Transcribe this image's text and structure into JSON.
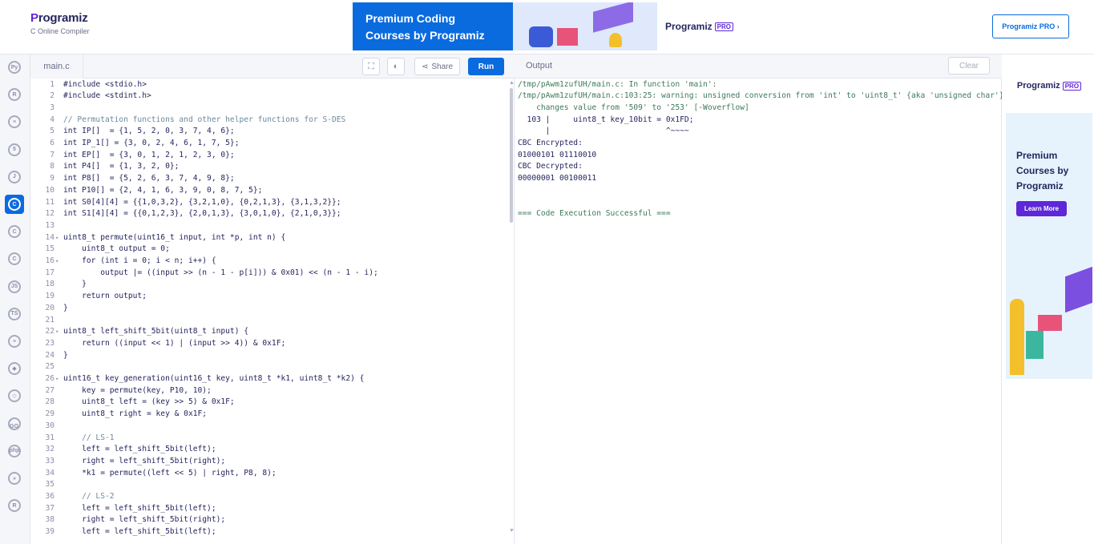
{
  "header": {
    "logo_name": "rogramiz",
    "logo_initial": "P",
    "logo_subtitle": "C Online Compiler",
    "banner_line1": "Premium Coding",
    "banner_line2": "Courses by Programiz",
    "banner_brand": "Programiz",
    "banner_pro": "PRO",
    "pro_button": "Programiz PRO ›"
  },
  "sidebar": {
    "languages": [
      {
        "name": "python-icon",
        "glyph": "Py"
      },
      {
        "name": "r-icon",
        "glyph": "R"
      },
      {
        "name": "sql-icon",
        "glyph": "≡"
      },
      {
        "name": "html-icon",
        "glyph": "5"
      },
      {
        "name": "java-icon",
        "glyph": "J"
      },
      {
        "name": "c-icon",
        "glyph": "C",
        "active": true
      },
      {
        "name": "cpp-icon",
        "glyph": "C"
      },
      {
        "name": "csharp-icon",
        "glyph": "C"
      },
      {
        "name": "javascript-icon",
        "glyph": "JS"
      },
      {
        "name": "typescript-icon",
        "glyph": "TS"
      },
      {
        "name": "kotlin-icon",
        "glyph": "≡"
      },
      {
        "name": "ruby-icon",
        "glyph": "◆"
      },
      {
        "name": "csharp2-icon",
        "glyph": "◇"
      },
      {
        "name": "go-icon",
        "glyph": "-GO"
      },
      {
        "name": "php-icon",
        "glyph": "php"
      },
      {
        "name": "swift-icon",
        "glyph": "»"
      },
      {
        "name": "rust-icon",
        "glyph": "R"
      }
    ]
  },
  "editor": {
    "tab_label": "main.c",
    "share_label": "Share",
    "run_label": "Run",
    "lines": [
      {
        "n": "1",
        "fold": "",
        "code": "#include <stdio.h>"
      },
      {
        "n": "2",
        "fold": "",
        "code": "#include <stdint.h>"
      },
      {
        "n": "3",
        "fold": "",
        "code": ""
      },
      {
        "n": "4",
        "fold": "",
        "code": "// Permutation functions and other helper functions for S-DES"
      },
      {
        "n": "5",
        "fold": "",
        "code": "int IP[]  = {1, 5, 2, 0, 3, 7, 4, 6};"
      },
      {
        "n": "6",
        "fold": "",
        "code": "int IP_1[] = {3, 0, 2, 4, 6, 1, 7, 5};"
      },
      {
        "n": "7",
        "fold": "",
        "code": "int EP[]  = {3, 0, 1, 2, 1, 2, 3, 0};"
      },
      {
        "n": "8",
        "fold": "",
        "code": "int P4[]  = {1, 3, 2, 0};"
      },
      {
        "n": "9",
        "fold": "",
        "code": "int P8[]  = {5, 2, 6, 3, 7, 4, 9, 8};"
      },
      {
        "n": "10",
        "fold": "",
        "code": "int P10[] = {2, 4, 1, 6, 3, 9, 0, 8, 7, 5};"
      },
      {
        "n": "11",
        "fold": "",
        "code": "int S0[4][4] = {{1,0,3,2}, {3,2,1,0}, {0,2,1,3}, {3,1,3,2}};"
      },
      {
        "n": "12",
        "fold": "",
        "code": "int S1[4][4] = {{0,1,2,3}, {2,0,1,3}, {3,0,1,0}, {2,1,0,3}};"
      },
      {
        "n": "13",
        "fold": "",
        "code": ""
      },
      {
        "n": "14",
        "fold": "▾",
        "code": "uint8_t permute(uint16_t input, int *p, int n) {"
      },
      {
        "n": "15",
        "fold": "",
        "code": "    uint8_t output = 0;"
      },
      {
        "n": "16",
        "fold": "▾",
        "code": "    for (int i = 0; i < n; i++) {"
      },
      {
        "n": "17",
        "fold": "",
        "code": "        output |= ((input >> (n - 1 - p[i])) & 0x01) << (n - 1 - i);"
      },
      {
        "n": "18",
        "fold": "",
        "code": "    }"
      },
      {
        "n": "19",
        "fold": "",
        "code": "    return output;"
      },
      {
        "n": "20",
        "fold": "",
        "code": "}"
      },
      {
        "n": "21",
        "fold": "",
        "code": ""
      },
      {
        "n": "22",
        "fold": "▾",
        "code": "uint8_t left_shift_5bit(uint8_t input) {"
      },
      {
        "n": "23",
        "fold": "",
        "code": "    return ((input << 1) | (input >> 4)) & 0x1F;"
      },
      {
        "n": "24",
        "fold": "",
        "code": "}"
      },
      {
        "n": "25",
        "fold": "",
        "code": ""
      },
      {
        "n": "26",
        "fold": "▾",
        "code": "uint16_t key_generation(uint16_t key, uint8_t *k1, uint8_t *k2) {"
      },
      {
        "n": "27",
        "fold": "",
        "code": "    key = permute(key, P10, 10);"
      },
      {
        "n": "28",
        "fold": "",
        "code": "    uint8_t left = (key >> 5) & 0x1F;"
      },
      {
        "n": "29",
        "fold": "",
        "code": "    uint8_t right = key & 0x1F;"
      },
      {
        "n": "30",
        "fold": "",
        "code": ""
      },
      {
        "n": "31",
        "fold": "",
        "code": "    // LS-1"
      },
      {
        "n": "32",
        "fold": "",
        "code": "    left = left_shift_5bit(left);"
      },
      {
        "n": "33",
        "fold": "",
        "code": "    right = left_shift_5bit(right);"
      },
      {
        "n": "34",
        "fold": "",
        "code": "    *k1 = permute((left << 5) | right, P8, 8);"
      },
      {
        "n": "35",
        "fold": "",
        "code": ""
      },
      {
        "n": "36",
        "fold": "",
        "code": "    // LS-2"
      },
      {
        "n": "37",
        "fold": "",
        "code": "    left = left_shift_5bit(left);"
      },
      {
        "n": "38",
        "fold": "",
        "code": "    right = left_shift_5bit(right);"
      },
      {
        "n": "39",
        "fold": "",
        "code": "    left = left_shift_5bit(left);"
      }
    ]
  },
  "output": {
    "title": "Output",
    "clear_label": "Clear",
    "lines": [
      {
        "text": "/tmp/pAwm1zufUH/main.c: In function 'main':",
        "kind": "warn"
      },
      {
        "text": "/tmp/pAwm1zufUH/main.c:103:25: warning: unsigned conversion from 'int' to 'uint8_t' {aka 'unsigned char'}",
        "kind": "warn"
      },
      {
        "text": "    changes value from '509' to '253' [-Woverflow]",
        "kind": "warn"
      },
      {
        "text": "  103 |     uint8_t key_10bit = 0x1FD;",
        "kind": "plain"
      },
      {
        "text": "      |                         ^~~~~",
        "kind": "plain"
      },
      {
        "text": "CBC Encrypted:",
        "kind": "plain"
      },
      {
        "text": "01000101 01110010",
        "kind": "plain"
      },
      {
        "text": "CBC Decrypted:",
        "kind": "plain"
      },
      {
        "text": "00000001 00100011",
        "kind": "plain"
      },
      {
        "text": "",
        "kind": "plain"
      },
      {
        "text": "",
        "kind": "plain"
      },
      {
        "text": "=== Code Execution Successful ===",
        "kind": "ok"
      }
    ]
  },
  "ad_right": {
    "brand": "Programiz",
    "pro": "PRO",
    "headline1": "Premium",
    "headline2": "Courses by",
    "headline3": "Programiz",
    "cta": "Learn More"
  },
  "colors": {
    "accent": "#0a6bde",
    "brand_purple": "#5e27d8",
    "code_keyword": "#1a3fbf",
    "code_comment": "#6b8aa0",
    "output_warn": "#3d7a58"
  }
}
